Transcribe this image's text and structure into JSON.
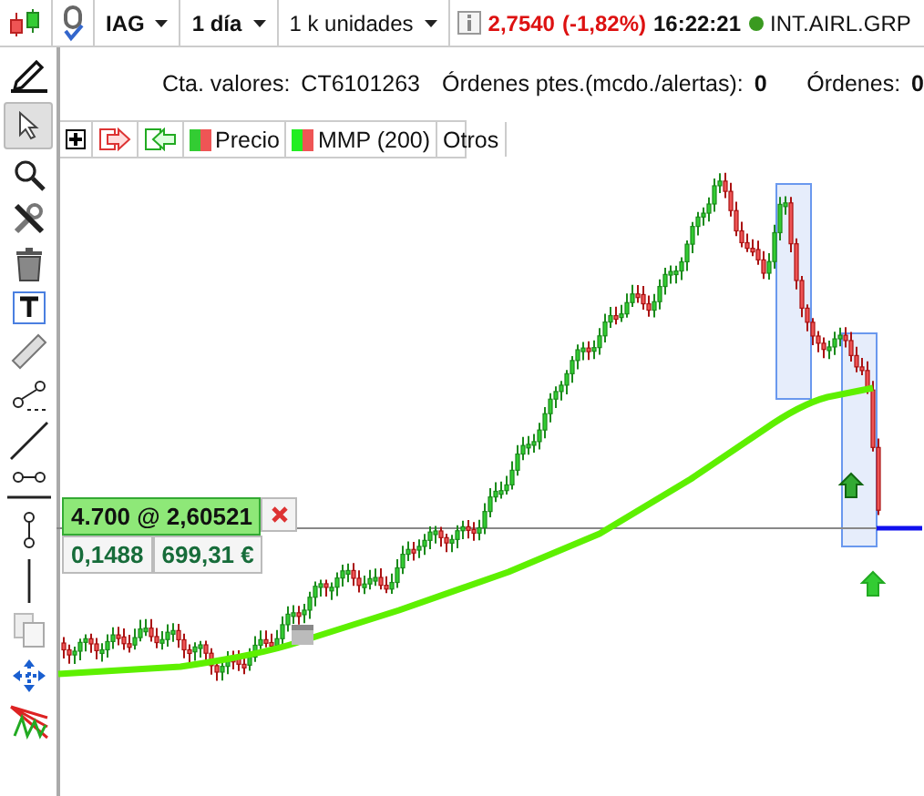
{
  "toolbar": {
    "symbol": "IAG",
    "period": "1 día",
    "units": "1 k unidades",
    "price": "2,7540",
    "change": "(-1,82%)",
    "time": "16:22:21",
    "market": "INT.AIRL.GRP"
  },
  "info": {
    "account_label": "Cta. valores:",
    "account": "CT6101263",
    "pending_label": "Órdenes ptes.(mcdo./alertas):",
    "pending": "0",
    "orders_label": "Órdenes:",
    "orders": "0"
  },
  "chart_tabs": [
    "Precio",
    "MMP (200)",
    "Otros"
  ],
  "position": {
    "quantity": "4.700",
    "at": "@",
    "price": "2,60521",
    "ratio": "0,1488",
    "value": "699,31 €"
  }
}
